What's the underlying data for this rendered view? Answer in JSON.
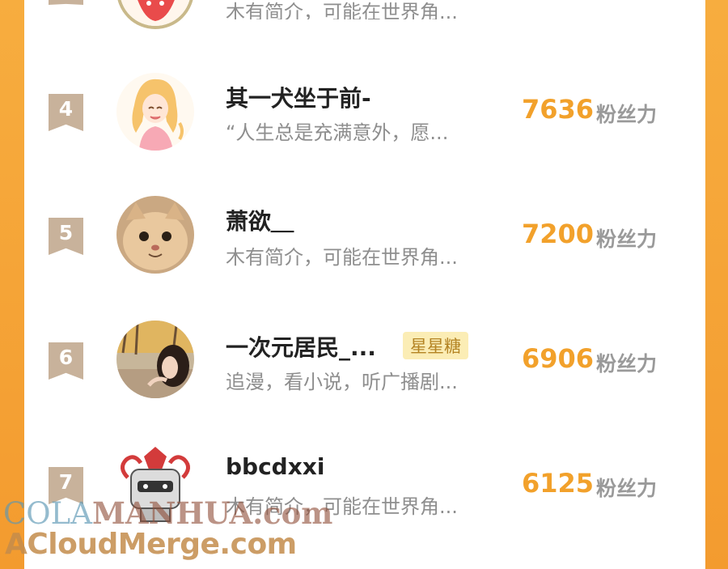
{
  "ranking": {
    "fans_label": "粉丝力",
    "rows": [
      {
        "rank": "",
        "name": "",
        "desc": "木有简介，可能在世界角...",
        "score": "",
        "tag": ""
      },
      {
        "rank": "4",
        "name": "其一犬坐于前-",
        "desc": "“人生总是充满意外，愿...",
        "score": "7636",
        "tag": ""
      },
      {
        "rank": "5",
        "name": "萧欲＿",
        "desc": "木有简介，可能在世界角...",
        "score": "7200",
        "tag": ""
      },
      {
        "rank": "6",
        "name": "一次元居民_...",
        "desc": "追漫，看小说，听广播剧...",
        "score": "6906",
        "tag": "星星糖"
      },
      {
        "rank": "7",
        "name": "bbcdxxi",
        "desc": "木有简介，可能在世界角...",
        "score": "6125",
        "tag": ""
      }
    ]
  },
  "watermark": {
    "line1_part1": "COLA",
    "line1_part2": "MANHUA.com",
    "line2": "ACloudMerge.com"
  },
  "colors": {
    "accent_orange": "#f2a12b",
    "background_orange": "#f7ad3f",
    "rank_badge": "#c8b29b",
    "tag_background": "#fbedb5",
    "tag_text": "#b48423"
  },
  "icons": {
    "avatar_row4": "anime-girl-avatar",
    "avatar_row5": "cat-avatar",
    "avatar_row6": "girl-photo-avatar",
    "avatar_row7": "robot-avatar"
  }
}
